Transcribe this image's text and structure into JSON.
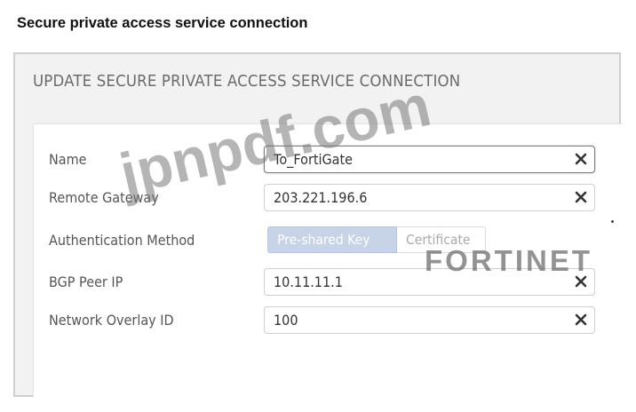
{
  "page": {
    "title": "Secure private access service connection"
  },
  "panel": {
    "header": "UPDATE SECURE PRIVATE ACCESS SERVICE CONNECTION"
  },
  "form": {
    "name": {
      "label": "Name",
      "value": "To_FortiGate"
    },
    "remote_gateway": {
      "label": "Remote Gateway",
      "value": "203.221.196.6"
    },
    "auth_method": {
      "label": "Authentication Method",
      "options": [
        "Pre-shared Key",
        "Certificate"
      ],
      "selected": "Pre-shared Key"
    },
    "bgp_peer_ip": {
      "label": "BGP Peer IP",
      "value": "10.11.11.1"
    },
    "network_overlay_id": {
      "label": "Network Overlay ID",
      "value": "100"
    }
  },
  "icons": {
    "clear": "close-icon"
  },
  "overlays": {
    "watermark": "jpnpdf.com",
    "brand_logo": "FORTINET"
  },
  "colors": {
    "selected_segment": "#c7d3e6",
    "panel_background": "#f2f2f3",
    "label_text": "#555555"
  }
}
